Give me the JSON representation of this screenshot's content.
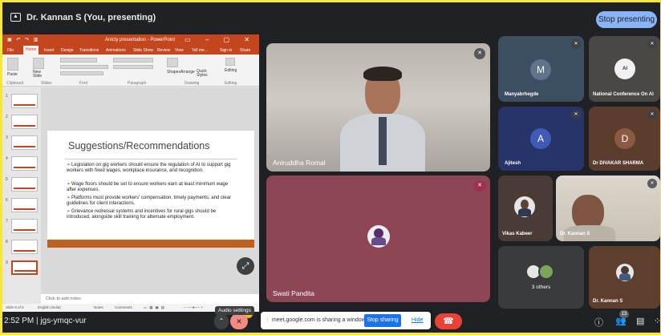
{
  "topbar": {
    "presenter": "Dr. Kannan S (You, presenting)",
    "stop_presenting": "Stop presenting"
  },
  "ppt": {
    "window_title": "Anicty presentation - PowerPoint",
    "tabs": [
      "File",
      "Home",
      "Insert",
      "Design",
      "Transitions",
      "Animations",
      "Slide Show",
      "Review",
      "View",
      "Tell me...",
      "Sign in",
      "Share"
    ],
    "ribbon_groups": [
      "Clipboard",
      "Slides",
      "Font",
      "Paragraph",
      "Drawing",
      "Editing"
    ],
    "ribbon_buttons": [
      "Paste",
      "New Slide",
      "Shapes",
      "Arrange",
      "Quick Styles",
      "Editing"
    ],
    "slide_numbers": [
      "1",
      "2",
      "3",
      "4",
      "5",
      "6",
      "7",
      "8",
      "9"
    ],
    "slide": {
      "title": "Suggestions/Recommendations",
      "bullets": [
        "Legislation on gig workers should ensure the regulation of AI to support gig workers with fixed wages, workplace insurance, and recognition.",
        "Wage floors should be set to ensure workers earn at least minimum wage after expenses.",
        "Platforms must provide workers' compensation, timely payments, and clear guidelines for client interactions.",
        "Grievance redressal systems and incentives for rural gigs should be introduced, alongside skill training for alternate employment."
      ]
    },
    "notes_placeholder": "Click to add notes",
    "status": {
      "slide_count": "Slide 9 of 9",
      "language": "English (India)",
      "notes": "Notes",
      "comments": "Comments"
    }
  },
  "participants": {
    "aniruddha": "Aniruddha Romal",
    "swati": "Swati Pandita",
    "manyabrhegde": "Manyabrhegde",
    "manyabrhegde_initial": "M",
    "conference": "National Conference On AI",
    "ajitesh": "Ajitesh",
    "ajitesh_initial": "A",
    "divakar": "Dr DIVAKAR SHARMA",
    "divakar_initial": "D",
    "vikas": "Vikas Kabeer",
    "kannan_tile": "Dr. Kannan S",
    "others": "3 others",
    "kannan_self": "Dr. Kannan S"
  },
  "controls": {
    "time": "2:52 PM",
    "meeting_code": "jgs-ymqc-vur",
    "audio_tooltip": "Audio settings",
    "people_count": "13"
  },
  "share_bar": {
    "message": "meet.google.com is sharing a window.",
    "stop": "Stop sharing",
    "hide": "Hide"
  },
  "colors": {
    "accent": "#8ab4f8",
    "ppt_brand": "#c4461e",
    "end_call": "#ea4335",
    "share_blue": "#1a73e8"
  }
}
